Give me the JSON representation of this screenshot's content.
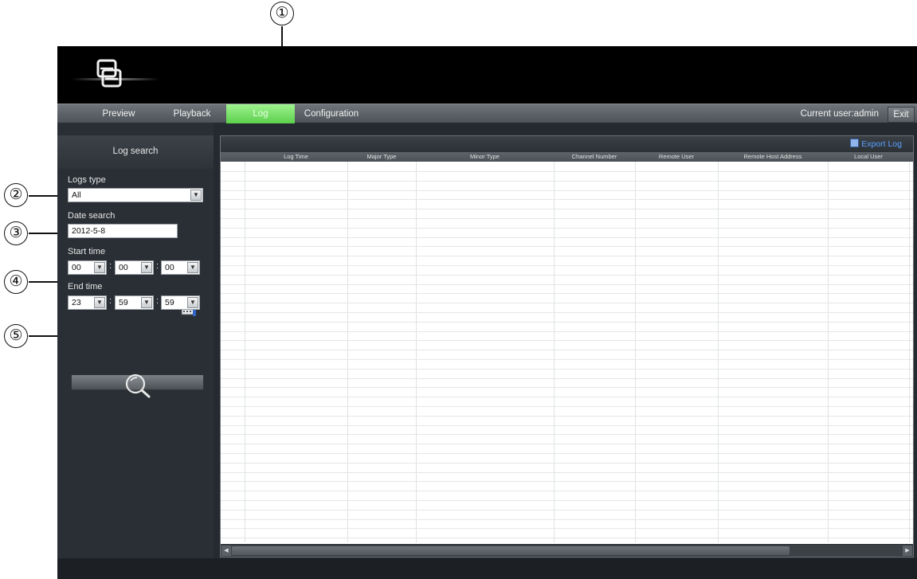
{
  "callouts": {
    "c1": "①",
    "c2": "②",
    "c3": "③",
    "c4": "④",
    "c5": "⑤"
  },
  "nav": {
    "items": [
      {
        "label": "Preview"
      },
      {
        "label": "Playback"
      },
      {
        "label": "Log"
      },
      {
        "label": "Configuration"
      }
    ],
    "current_user": "Current user:admin",
    "exit_label": "Exit",
    "active_color": "#5bd04b"
  },
  "panel": {
    "title": "Log search",
    "logs_type_label": "Logs type",
    "logs_type_value": "All",
    "date_label": "Date search",
    "date_value": "2012-5-8",
    "start_label": "Start time",
    "start": {
      "hour": "00",
      "minute": "00",
      "second": "00"
    },
    "end_label": "End time",
    "end": {
      "hour": "23",
      "minute": "59",
      "second": "59"
    },
    "colon": ":"
  },
  "table": {
    "export_label": "Export Log",
    "columns": [
      "Log Time",
      "Major Type",
      "Minor Type",
      "Channel Number",
      "Remote User",
      "Remote Host Address",
      "Local User"
    ]
  },
  "icons": [
    "logo-icon",
    "chevron-down-icon",
    "calendar-icon",
    "search-icon",
    "save-icon"
  ]
}
